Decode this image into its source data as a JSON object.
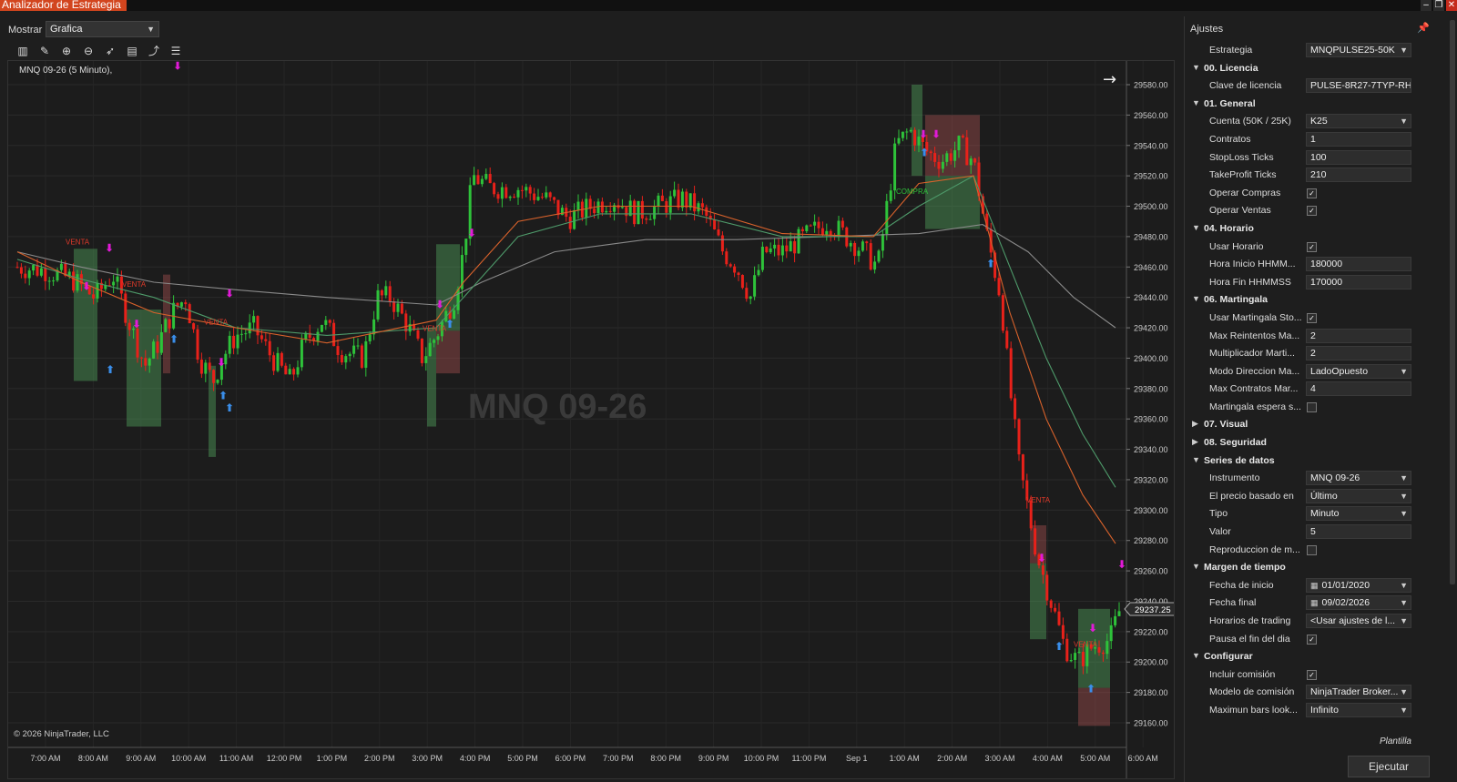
{
  "window": {
    "title": "Analizador de Estrategia"
  },
  "display": {
    "mostrar_label": "Mostrar",
    "mostrar_value": "Grafica"
  },
  "chart": {
    "series_label": "MNQ 09-26 (5 Minuto),",
    "watermark": "MNQ 09-26",
    "copyright": "© 2026 NinjaTrader, LLC",
    "last_price": "29237.25",
    "price_ticks": [
      "29580.00",
      "29560.00",
      "29540.00",
      "29520.00",
      "29500.00",
      "29480.00",
      "29460.00",
      "29440.00",
      "29420.00",
      "29400.00",
      "29380.00",
      "29360.00",
      "29340.00",
      "29320.00",
      "29300.00",
      "29280.00",
      "29260.00",
      "29240.00",
      "29220.00",
      "29200.00",
      "29180.00",
      "29160.00"
    ],
    "time_ticks": [
      "7:00 AM",
      "8:00 AM",
      "9:00 AM",
      "10:00 AM",
      "11:00 AM",
      "12:00 PM",
      "1:00 PM",
      "2:00 PM",
      "3:00 PM",
      "4:00 PM",
      "5:00 PM",
      "6:00 PM",
      "7:00 PM",
      "8:00 PM",
      "9:00 PM",
      "10:00 PM",
      "11:00 PM",
      "Sep 1",
      "1:00 AM",
      "2:00 AM",
      "3:00 AM",
      "4:00 AM",
      "5:00 AM",
      "6:00 AM"
    ],
    "trade_labels": [
      "VENTA",
      "VENTA",
      "VENTA",
      "VENTA",
      "COMPRA",
      "VENTA",
      "VENTA"
    ],
    "colors": {
      "up": "#2ec23a",
      "down": "#e8211a",
      "ema_fast": "#d9622b",
      "ema_mid": "#4e9a6a",
      "ema_slow": "#8a8a8a"
    }
  },
  "settings": {
    "header": "Ajustes",
    "rows": [
      {
        "type": "prop",
        "label": "Estrategia",
        "value": "MNQPULSE25-50K",
        "dropdown": true
      },
      {
        "type": "cat",
        "label": "00. Licencia",
        "expanded": true
      },
      {
        "type": "prop",
        "label": "Clave de licencia",
        "value": "PULSE-8R27-7TYP-RH"
      },
      {
        "type": "cat",
        "label": "01. General",
        "expanded": true
      },
      {
        "type": "prop",
        "label": "Cuenta (50K / 25K)",
        "value": "K25",
        "dropdown": true
      },
      {
        "type": "prop",
        "label": "Contratos",
        "value": "1"
      },
      {
        "type": "prop",
        "label": "StopLoss Ticks",
        "value": "100"
      },
      {
        "type": "prop",
        "label": "TakeProfit Ticks",
        "value": "210"
      },
      {
        "type": "check",
        "label": "Operar Compras",
        "checked": true
      },
      {
        "type": "check",
        "label": "Operar Ventas",
        "checked": true
      },
      {
        "type": "cat",
        "label": "04. Horario",
        "expanded": true
      },
      {
        "type": "check",
        "label": "Usar Horario",
        "checked": true
      },
      {
        "type": "prop",
        "label": "Hora Inicio HHMM...",
        "value": "180000"
      },
      {
        "type": "prop",
        "label": "Hora Fin HHMMSS",
        "value": "170000"
      },
      {
        "type": "cat",
        "label": "06. Martingala",
        "expanded": true
      },
      {
        "type": "check",
        "label": "Usar Martingala Sto...",
        "checked": true
      },
      {
        "type": "prop",
        "label": "Max Reintentos Ma...",
        "value": "2"
      },
      {
        "type": "prop",
        "label": "Multiplicador Marti...",
        "value": "2"
      },
      {
        "type": "prop",
        "label": "Modo Direccion Ma...",
        "value": "LadoOpuesto",
        "dropdown": true
      },
      {
        "type": "prop",
        "label": "Max Contratos Mar...",
        "value": "4"
      },
      {
        "type": "check",
        "label": "Martingala espera s...",
        "checked": false
      },
      {
        "type": "cat",
        "label": "07. Visual",
        "expanded": false
      },
      {
        "type": "cat",
        "label": "08. Seguridad",
        "expanded": false
      },
      {
        "type": "cat",
        "label": "Series de datos",
        "expanded": true
      },
      {
        "type": "prop",
        "label": "Instrumento",
        "value": "MNQ 09-26",
        "dropdown": true
      },
      {
        "type": "prop",
        "label": "El precio basado en",
        "value": "Último",
        "dropdown": true
      },
      {
        "type": "prop",
        "label": "Tipo",
        "value": "Minuto",
        "dropdown": true
      },
      {
        "type": "prop",
        "label": "Valor",
        "value": "5"
      },
      {
        "type": "check",
        "label": "Reproduccion de m...",
        "checked": false
      },
      {
        "type": "cat",
        "label": "Margen de tiempo",
        "expanded": true
      },
      {
        "type": "prop",
        "label": "Fecha de inicio",
        "value": "01/01/2020",
        "dropdown": true,
        "calendar": true
      },
      {
        "type": "prop",
        "label": "Fecha final",
        "value": "09/02/2026",
        "dropdown": true,
        "calendar": true
      },
      {
        "type": "prop",
        "label": "Horarios de trading",
        "value": "<Usar ajustes de l...",
        "dropdown": true
      },
      {
        "type": "check",
        "label": "Pausa el fin del dia",
        "checked": true
      },
      {
        "type": "cat",
        "label": "Configurar",
        "expanded": true
      },
      {
        "type": "check",
        "label": "Incluir comisión",
        "checked": true
      },
      {
        "type": "prop",
        "label": "Modelo de comisión",
        "value": "NinjaTrader Broker...",
        "dropdown": true
      },
      {
        "type": "prop",
        "label": "Maximun bars look...",
        "value": "Infinito",
        "dropdown": true
      }
    ],
    "template_label": "Plantilla",
    "run_button": "Ejecutar"
  }
}
